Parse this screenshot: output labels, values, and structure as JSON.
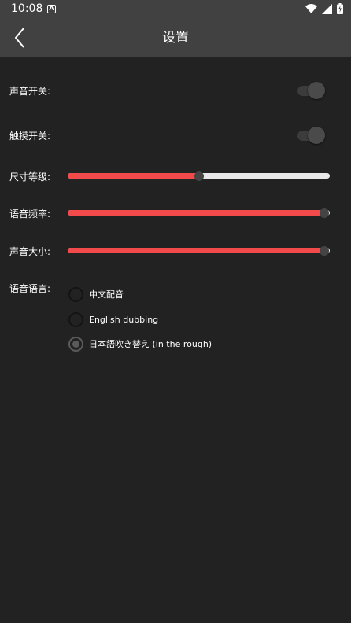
{
  "status_bar": {
    "time": "10:08",
    "notification_icon": "a-box-icon"
  },
  "app_bar": {
    "title": "设置",
    "back_icon": "chevron-left-icon"
  },
  "settings": {
    "sound_switch": {
      "label": "声音开关:",
      "on": true
    },
    "touch_switch": {
      "label": "触摸开关:",
      "on": true
    },
    "size_level": {
      "label": "尺寸等级:",
      "value_percent": 50
    },
    "voice_frequency": {
      "label": "语音频率:",
      "value_percent": 98
    },
    "volume": {
      "label": "声音大小:",
      "value_percent": 98
    },
    "voice_language": {
      "label": "语音语言:",
      "options": [
        {
          "label": "中文配音",
          "selected": false
        },
        {
          "label": "English dubbing",
          "selected": false
        },
        {
          "label": "日本語吹き替え (in the rough)",
          "selected": true
        }
      ]
    }
  },
  "colors": {
    "background": "#222222",
    "app_bar": "#414141",
    "slider_fill": "#f24a4a",
    "slider_rail": "#e8e8e8"
  }
}
